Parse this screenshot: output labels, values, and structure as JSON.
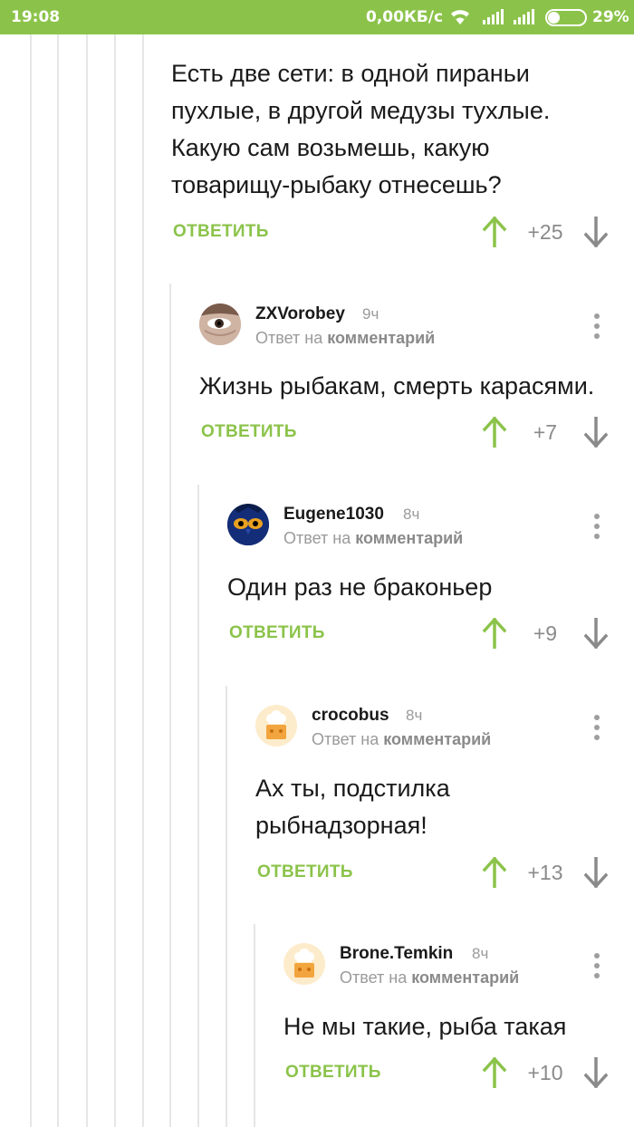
{
  "status_bar": {
    "time": "19:08",
    "network_speed": "0,00КБ/с",
    "battery_percent": "29%",
    "wifi_icon": "wifi-icon",
    "signal_icon": "signal-icon",
    "battery_level": 0.29
  },
  "colors": {
    "accent": "#8bc34a",
    "text": "#1a1a1a",
    "muted": "#9a9a9a",
    "thread_line": "#e6e6e6"
  },
  "comments": [
    {
      "text_lines": [
        "Есть две сети: в одной пираньи",
        "пухлые, в другой медузы тухлые.",
        "Какую сам возьмешь, какую",
        "товарищу-рыбаку отнесешь?"
      ],
      "reply_label": "ОТВЕТИТЬ",
      "rating": "+25"
    },
    {
      "username": "ZXVorobey",
      "time": "9ч",
      "meta_prefix": "Ответ на",
      "meta_link": "комментарий",
      "avatar_icon": "user-eye-avatar",
      "text_lines": [
        "Жизнь рыбакам, смерть карасями."
      ],
      "reply_label": "ОТВЕТИТЬ",
      "rating": "+7"
    },
    {
      "username": "Eugene1030",
      "time": "8ч",
      "meta_prefix": "Ответ на",
      "meta_link": "комментарий",
      "avatar_icon": "owl-avatar",
      "text_lines": [
        "Один раз не браконьер"
      ],
      "reply_label": "ОТВЕТИТЬ",
      "rating": "+9"
    },
    {
      "username": "crocobus",
      "time": "8ч",
      "meta_prefix": "Ответ на",
      "meta_link": "комментарий",
      "avatar_icon": "default-chef-avatar",
      "text_lines": [
        "Ах ты, подстилка",
        "рыбнадзорная!"
      ],
      "reply_label": "ОТВЕТИТЬ",
      "rating": "+13"
    },
    {
      "username": "Brone.Temkin",
      "time": "8ч",
      "meta_prefix": "Ответ на",
      "meta_link": "комментарий",
      "avatar_icon": "default-chef-avatar",
      "text_lines": [
        "Не мы такие, рыба такая"
      ],
      "reply_label": "ОТВЕТИТЬ",
      "rating": "+10"
    }
  ]
}
